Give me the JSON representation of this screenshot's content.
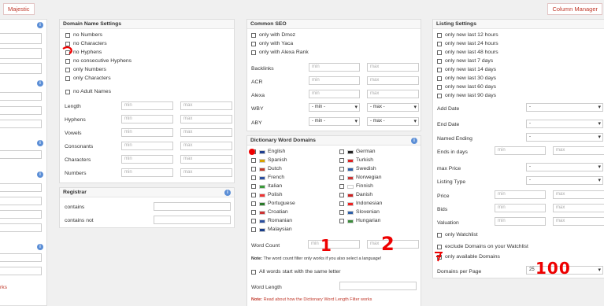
{
  "top_buttons": {
    "left": "Majestic",
    "right": "Column Manager"
  },
  "left_col": {
    "partial": "rks"
  },
  "domain_name_settings": {
    "title": "Domain Name Settings",
    "checks": [
      "no Numbers",
      "no Characters",
      "no Hyphens",
      "no consecutive Hyphens",
      "only Numbers",
      "only Characters",
      "no Adult Names"
    ],
    "ranges": [
      "Length",
      "Hyphens",
      "Vowels",
      "Consonants",
      "Characters",
      "Numbers"
    ],
    "min": "min",
    "max": "max"
  },
  "registrar": {
    "title": "Registrar",
    "rows": [
      "contains",
      "contains not"
    ]
  },
  "common_seo": {
    "title": "Common SEO",
    "checks": [
      "only with Dmoz",
      "only with Yaca",
      "only with Alexa Rank"
    ],
    "ranges": [
      "Backlinks",
      "ACR",
      "Alexa"
    ],
    "selects": [
      {
        "label": "WBY",
        "min": "- min -",
        "max": "- max -"
      },
      {
        "label": "ABY",
        "min": "- min -",
        "max": "- max -"
      }
    ]
  },
  "dictionary": {
    "title": "Dictionary Word Domains",
    "languages_left": [
      "English",
      "Spanish",
      "Dutch",
      "French",
      "Italian",
      "Polish",
      "Portuguese",
      "Croatian",
      "Romanian",
      "Malaysian"
    ],
    "languages_right": [
      "German",
      "Turkish",
      "Swedish",
      "Norwegian",
      "Finnish",
      "Danish",
      "Indonesian",
      "Slovenian",
      "Hungarian"
    ],
    "word_count_label": "Word Count",
    "note_prefix": "Note:",
    "note_text": "The word count filter only works if you also select a language!",
    "same_letter": "All words start with the same letter",
    "word_length": "Word Length",
    "bottom_note_prefix": "Note:",
    "bottom_note_text": "Read about how the Dictionary Word Length Filter works"
  },
  "listing": {
    "title": "Listing Settings",
    "checks": [
      "only new last 12 hours",
      "only new last 24 hours",
      "only new last 48 hours",
      "only new last 7 days",
      "only new last 14 days",
      "only new last 30 days",
      "only new last 60 days",
      "only new last 90 days"
    ],
    "selects": [
      "Add Date",
      "End Date",
      "Named Ending"
    ],
    "ends_in_days": "Ends in days",
    "selects2": [
      "max Price",
      "Listing Type"
    ],
    "ranges": [
      "Price",
      "Bids",
      "Valuation"
    ],
    "watch_checks": [
      "only Watchlist",
      "exclude Domains on your Watchlist",
      "only available Domains"
    ],
    "per_page_label": "Domains per Page",
    "per_page_value": "25"
  },
  "annotations": {
    "word_min": "1",
    "word_max": "2",
    "per_page": "100"
  },
  "colors": {
    "accent": "#c0392b",
    "info": "#5b8ed6",
    "annotation": "#ee0000"
  }
}
